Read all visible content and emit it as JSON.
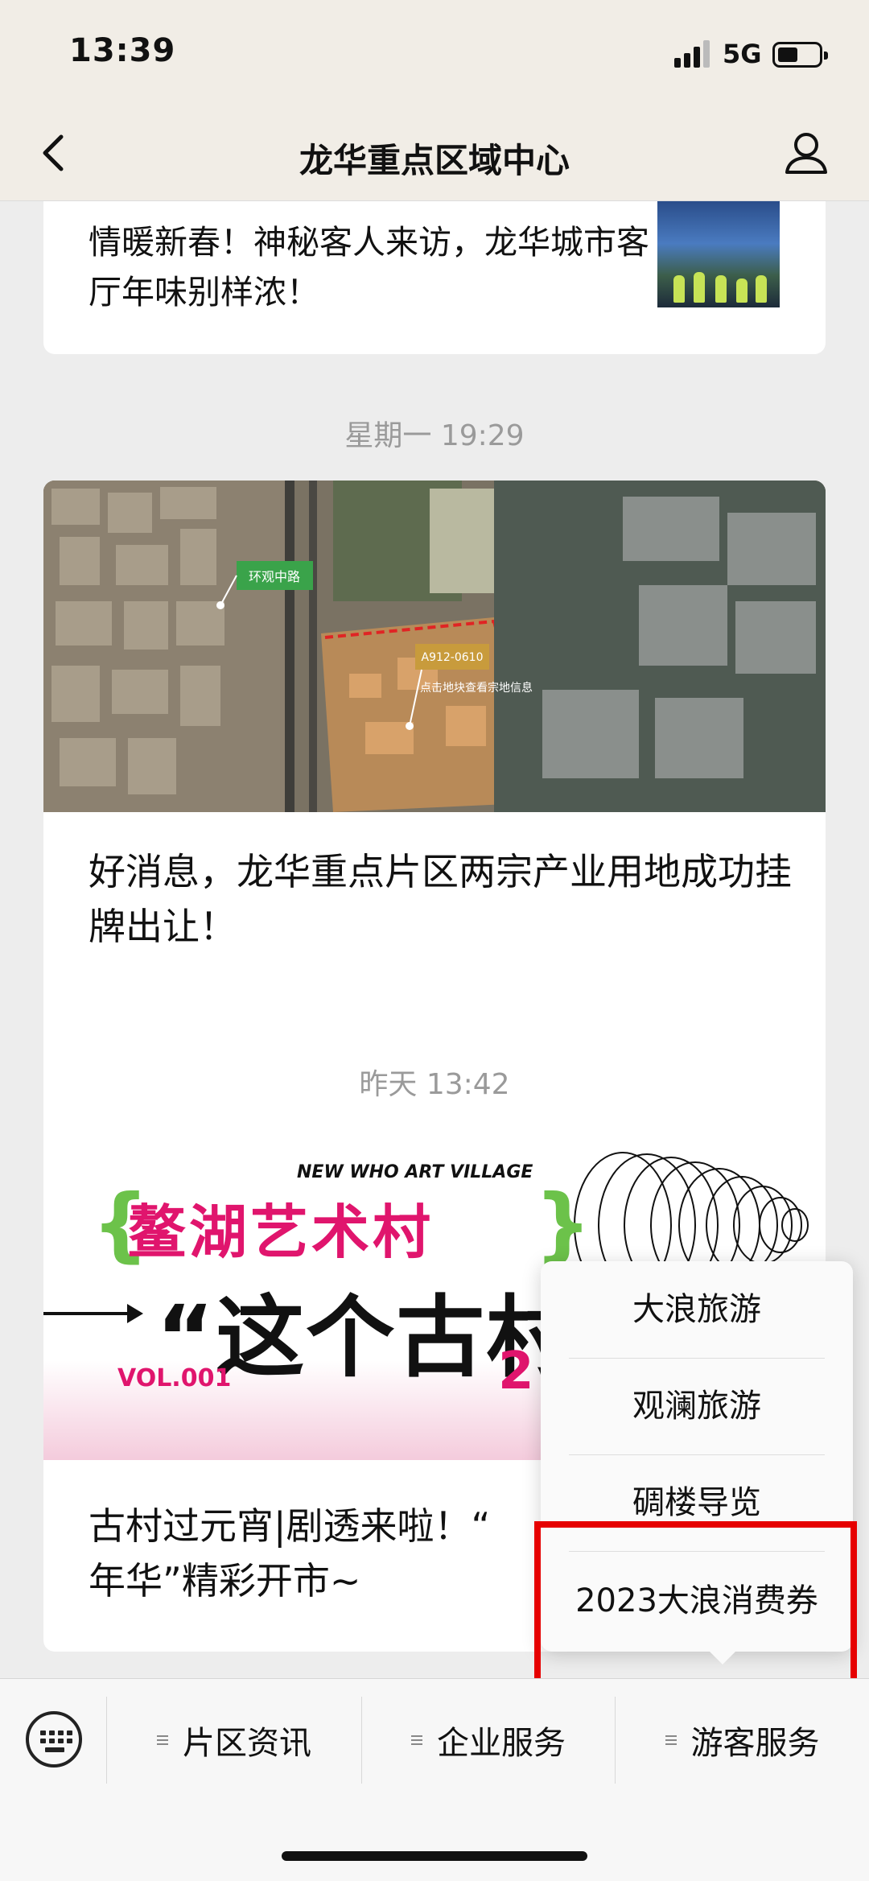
{
  "status_bar": {
    "time": "13:39",
    "network": "5G"
  },
  "nav": {
    "title": "龙华重点区域中心"
  },
  "feed": {
    "top_card": {
      "title": "情暖新春！神秘客人来访，龙华城市客厅年味别样浓！"
    },
    "timestamp_1": "星期一 19:29",
    "aerial_card": {
      "map_label_road": "环观中路",
      "map_label_plot": "A912-0610",
      "map_label_hint": "点击地块查看宗地信息",
      "title": "好消息，龙华重点片区两宗产业用地成功挂牌出让！"
    },
    "timestamp_2": "昨天 13:42",
    "art_card": {
      "en_title": "NEW WHO ART VILLAGE",
      "cn_title": "鳌湖艺术村",
      "headline": "“这个古村要",
      "vol": "VOL.001",
      "num": "2",
      "title_line1": "古村过元宵|剧透来啦！“",
      "title_line2": "年华”精彩开市~"
    }
  },
  "popup_menu": {
    "items": [
      {
        "label": "大浪旅游"
      },
      {
        "label": "观澜旅游"
      },
      {
        "label": "碉楼导览"
      },
      {
        "label": "2023大浪消费券"
      }
    ]
  },
  "bottom_menu": {
    "items": [
      {
        "label": "片区资讯"
      },
      {
        "label": "企业服务"
      },
      {
        "label": "游客服务"
      }
    ]
  },
  "colors": {
    "highlight": "#e60000",
    "accent_pink": "#e0156d",
    "accent_green": "#6cc24a"
  },
  "icons": [
    "back-chevron-icon",
    "profile-icon",
    "keyboard-icon",
    "menu-lines-icon",
    "signal-icon",
    "battery-icon"
  ]
}
